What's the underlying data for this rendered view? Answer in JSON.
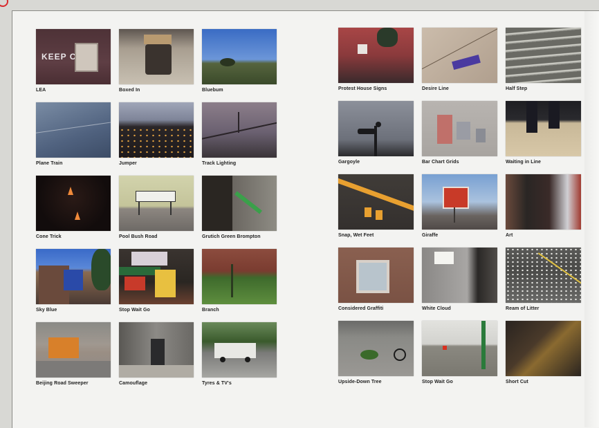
{
  "left_page": {
    "photos": [
      {
        "caption": "LEA",
        "photo_text": "KEEP C"
      },
      {
        "caption": "Boxed In"
      },
      {
        "caption": "Bluebum"
      },
      {
        "caption": "Plane Train"
      },
      {
        "caption": "Jumper"
      },
      {
        "caption": "Track Lighting"
      },
      {
        "caption": "Cone Trick"
      },
      {
        "caption": "Pool Bush Road"
      },
      {
        "caption": "Grutich Green Brompton"
      },
      {
        "caption": "Sky Blue"
      },
      {
        "caption": "Stop Wait Go"
      },
      {
        "caption": "Branch"
      },
      {
        "caption": "Beijing Road Sweeper"
      },
      {
        "caption": "Camouflage"
      },
      {
        "caption": "Tyres & TV's"
      }
    ]
  },
  "right_page": {
    "photos": [
      {
        "caption": "Protest House Signs"
      },
      {
        "caption": "Desire Line"
      },
      {
        "caption": "Half Step"
      },
      {
        "caption": "Gargoyle"
      },
      {
        "caption": "Bar Chart Grids"
      },
      {
        "caption": "Waiting in Line"
      },
      {
        "caption": "Snap, Wet Feet"
      },
      {
        "caption": "Giraffe"
      },
      {
        "caption": "Art"
      },
      {
        "caption": "Considered Graffiti"
      },
      {
        "caption": "White Cloud"
      },
      {
        "caption": "Ream of Litter"
      },
      {
        "caption": "Upside-Down Tree"
      },
      {
        "caption": "Stop Wait Go"
      },
      {
        "caption": "Short Cut"
      }
    ]
  }
}
